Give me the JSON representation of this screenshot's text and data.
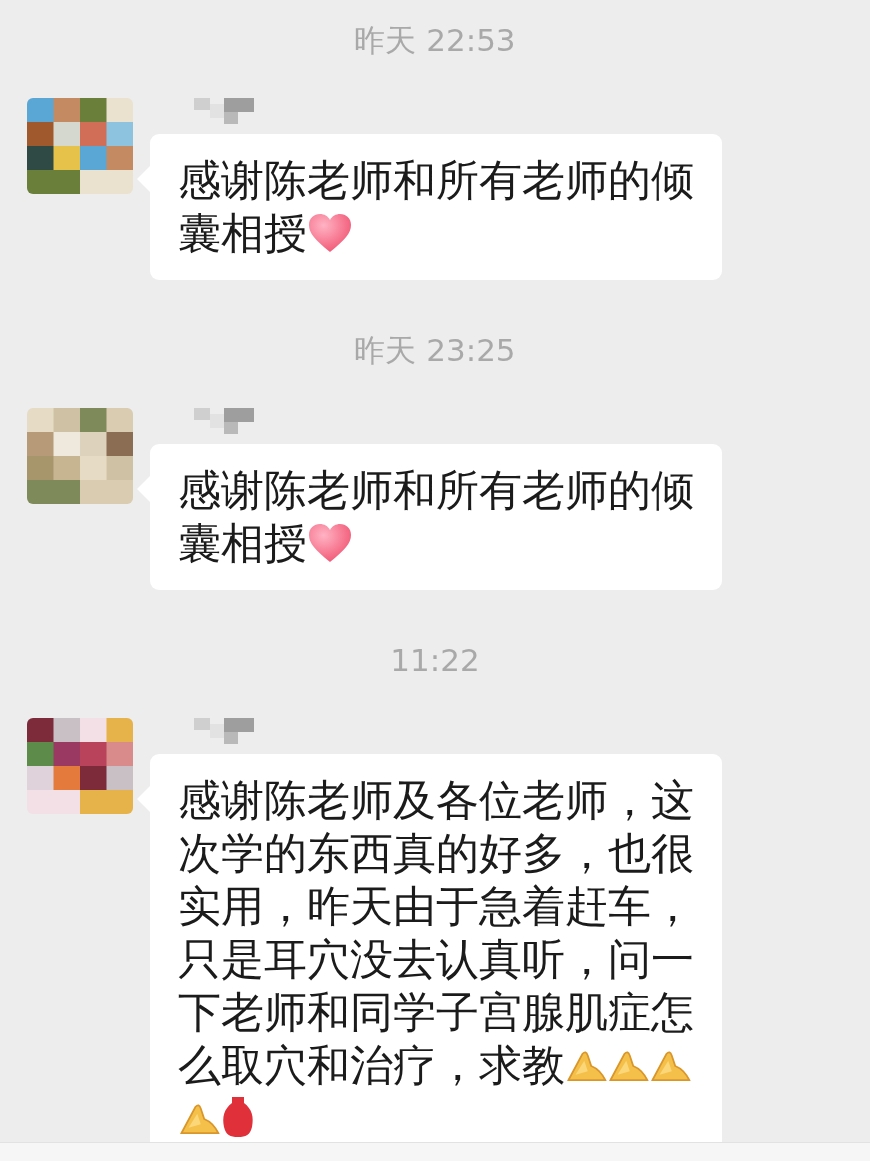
{
  "messages": [
    {
      "kind": "time",
      "text": "昨天 22:53"
    },
    {
      "kind": "message",
      "avatar": {
        "kind": "picture"
      },
      "name": {
        "kind": "redacted"
      },
      "text": "感谢陈老师和所有老师的倾囊相授",
      "icons": [
        {
          "kind": "heart"
        }
      ]
    },
    {
      "kind": "time",
      "text": "昨天 23:25"
    },
    {
      "kind": "message",
      "avatar": {
        "kind": "picture"
      },
      "name": {
        "kind": "redacted"
      },
      "text": "感谢陈老师和所有老师的倾囊相授",
      "icons": [
        {
          "kind": "heart"
        }
      ]
    },
    {
      "kind": "time",
      "text": "11:22"
    },
    {
      "kind": "message",
      "avatar": {
        "kind": "picture"
      },
      "name": {
        "kind": "redacted"
      },
      "text": "感谢陈老师及各位老师，这次学的东西真的好多，也很实用，昨天由于急着赶车，只是耳穴没去认真听，问一下老师和同学子宫腺肌症怎么取穴和治疗，求教",
      "icons": [
        {
          "kind": "folded-hands"
        },
        {
          "kind": "folded-hands"
        },
        {
          "kind": "folded-hands"
        },
        {
          "kind": "folded-hands"
        },
        {
          "kind": "vase"
        }
      ]
    }
  ],
  "input_bar": {
    "kind": "bar"
  }
}
